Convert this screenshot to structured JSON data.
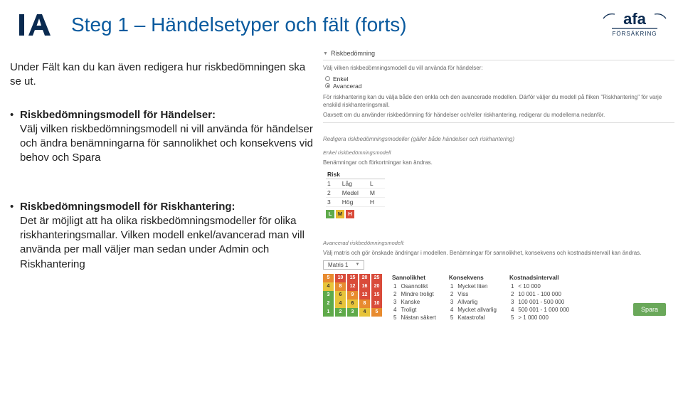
{
  "header": {
    "logo_text": "IA",
    "title": "Steg 1 – Händelsetyper och fält (forts)",
    "brand": "afa",
    "brand_sub": "FÖRSÄKRING"
  },
  "left": {
    "intro": "Under Fält kan du kan även redigera hur riskbedömningen ska se ut.",
    "bullet1_title": "Riskbedömningsmodell för Händelser:",
    "bullet1_body": "Välj vilken riskbedömningsmodell ni vill använda för händelser och ändra benämningarna för sannolikhet och konsekvens vid behov och Spara",
    "bullet2_title": "Riskbedömningsmodell för Riskhantering:",
    "bullet2_body": "Det är möjligt att ha olika riskbedömningsmodeller för olika riskhanteringsmallar. Vilken modell enkel/avancerad man vill använda per mall väljer man sedan under Admin och Riskhantering"
  },
  "panel": {
    "caret": "▼",
    "title": "Riskbedömning",
    "choose_model": "Välj vilken riskbedömningsmodell du vill använda för händelser:",
    "opt_enkel": "Enkel",
    "opt_avancerad": "Avancerad",
    "riskhant_text": "För riskhantering kan du välja både den enkla och den avancerade modellen. Därför väljer du modell på fliken \"Riskhantering\" för varje enskild riskhanteringsmall.",
    "oavsett_text": "Oavsett om du använder riskbedömning för händelser och/eller riskhantering, redigerar du modellerna nedanför.",
    "edit_header": "Redigera riskbedömningsmodeller (gäller både händelser och riskhantering)",
    "enkel_head": "Enkel riskbedömningsmodell",
    "enkel_sub": "Benämningar och förkortningar kan ändras.",
    "risk_col": "Risk",
    "risk_rows": [
      {
        "n": "1",
        "name": "Låg",
        "abbr": "L"
      },
      {
        "n": "2",
        "name": "Medel",
        "abbr": "M"
      },
      {
        "n": "3",
        "name": "Hög",
        "abbr": "H"
      }
    ],
    "lmh": [
      "L",
      "M",
      "H"
    ],
    "adv_head": "Avancerad riskbedömningsmodell:",
    "adv_sub": "Välj matris och gör önskade ändringar i modellen. Benämningar för sannolikhet, konsekvens och kostnadsintervall kan ändras.",
    "matris_label": "Matris 1",
    "matrix": [
      [
        {
          "v": "5",
          "c": "c-o"
        },
        {
          "v": "10",
          "c": "c-r"
        },
        {
          "v": "15",
          "c": "c-r"
        },
        {
          "v": "20",
          "c": "c-r"
        },
        {
          "v": "25",
          "c": "c-r"
        }
      ],
      [
        {
          "v": "4",
          "c": "c-y"
        },
        {
          "v": "8",
          "c": "c-o"
        },
        {
          "v": "12",
          "c": "c-r"
        },
        {
          "v": "16",
          "c": "c-r"
        },
        {
          "v": "20",
          "c": "c-r"
        }
      ],
      [
        {
          "v": "3",
          "c": "c-g"
        },
        {
          "v": "6",
          "c": "c-y"
        },
        {
          "v": "9",
          "c": "c-o"
        },
        {
          "v": "12",
          "c": "c-r"
        },
        {
          "v": "15",
          "c": "c-r"
        }
      ],
      [
        {
          "v": "2",
          "c": "c-g"
        },
        {
          "v": "4",
          "c": "c-y"
        },
        {
          "v": "6",
          "c": "c-y"
        },
        {
          "v": "8",
          "c": "c-o"
        },
        {
          "v": "10",
          "c": "c-r"
        }
      ],
      [
        {
          "v": "1",
          "c": "c-g"
        },
        {
          "v": "2",
          "c": "c-g"
        },
        {
          "v": "3",
          "c": "c-g"
        },
        {
          "v": "4",
          "c": "c-y"
        },
        {
          "v": "5",
          "c": "c-o"
        }
      ]
    ],
    "col_sannolikhet": "Sannolikhet",
    "sannolikhet": [
      {
        "n": "1",
        "t": "Osannolikt"
      },
      {
        "n": "2",
        "t": "Mindre troligt"
      },
      {
        "n": "3",
        "t": "Kanske"
      },
      {
        "n": "4",
        "t": "Troligt"
      },
      {
        "n": "5",
        "t": "Nästan säkert"
      }
    ],
    "col_konsekvens": "Konsekvens",
    "konsekvens": [
      {
        "n": "1",
        "t": "Mycket liten"
      },
      {
        "n": "2",
        "t": "Viss"
      },
      {
        "n": "3",
        "t": "Allvarlig"
      },
      {
        "n": "4",
        "t": "Mycket allvarlig"
      },
      {
        "n": "5",
        "t": "Katastrofal"
      }
    ],
    "col_kostnad": "Kostnadsintervall",
    "kostnad": [
      {
        "n": "1",
        "t": "< 10 000"
      },
      {
        "n": "2",
        "t": "10 001 - 100 000"
      },
      {
        "n": "3",
        "t": "100 001 - 500 000"
      },
      {
        "n": "4",
        "t": "500 001 - 1 000 000"
      },
      {
        "n": "5",
        "t": "> 1 000 000"
      }
    ],
    "save": "Spara"
  }
}
